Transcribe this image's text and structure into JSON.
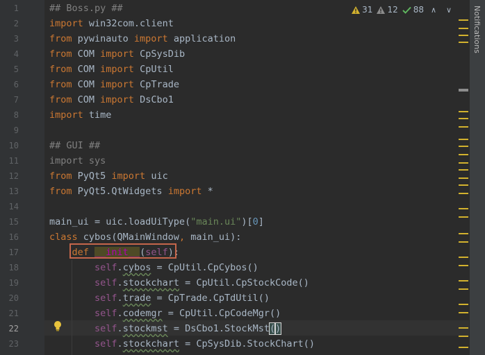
{
  "editor": {
    "status": {
      "warnings": "31",
      "weak_warnings": "12",
      "typos": "88",
      "warning_color": "#d3b22e",
      "ok_color": "#5fb65f"
    },
    "right_tab": "Notifications",
    "line_numbers": [
      "1",
      "2",
      "3",
      "4",
      "5",
      "6",
      "7",
      "8",
      "9",
      "10",
      "11",
      "12",
      "13",
      "14",
      "15",
      "16",
      "17",
      "18",
      "19",
      "20",
      "21",
      "22",
      "23"
    ],
    "current_line": "22"
  }
}
